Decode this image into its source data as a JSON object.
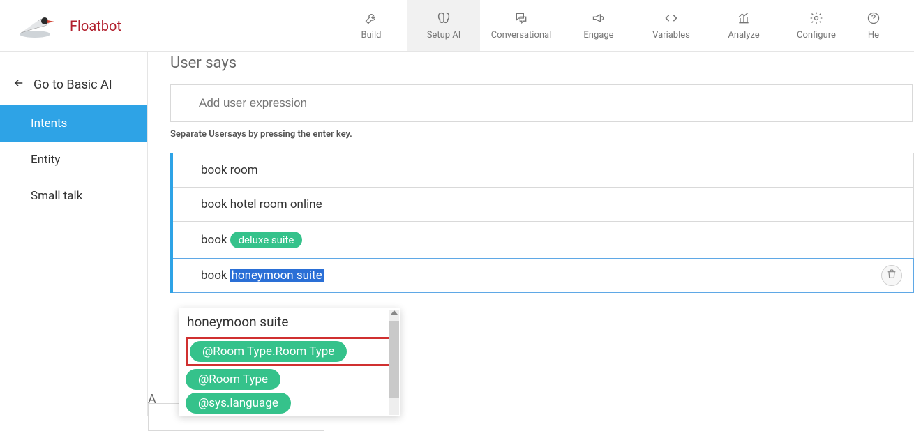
{
  "brand": {
    "name": "Floatbot"
  },
  "nav": {
    "items": [
      {
        "label": "Build"
      },
      {
        "label": "Setup AI"
      },
      {
        "label": "Conversational"
      },
      {
        "label": "Engage"
      },
      {
        "label": "Variables"
      },
      {
        "label": "Analyze"
      },
      {
        "label": "Configure"
      },
      {
        "label": "He"
      }
    ]
  },
  "sidebar": {
    "back": "Go to Basic AI",
    "items": [
      {
        "label": "Intents"
      },
      {
        "label": "Entity"
      },
      {
        "label": "Small talk"
      }
    ]
  },
  "section": {
    "title": "User says",
    "placeholder": "Add user expression",
    "hint": "Separate Usersays by pressing the enter key."
  },
  "usersays": {
    "r0": "book room",
    "r1": "book hotel room online",
    "r2": {
      "prefix": "book ",
      "chip": "deluxe suite"
    },
    "r3": {
      "prefix": "book ",
      "highlight": "honeymoon suite"
    }
  },
  "dropdown": {
    "heading": "honeymoon suite",
    "opts": [
      {
        "label": "@Room Type.Room Type"
      },
      {
        "label": "@Room Type"
      },
      {
        "label": "@sys.language"
      }
    ]
  },
  "ghost": {
    "letter": "A"
  }
}
